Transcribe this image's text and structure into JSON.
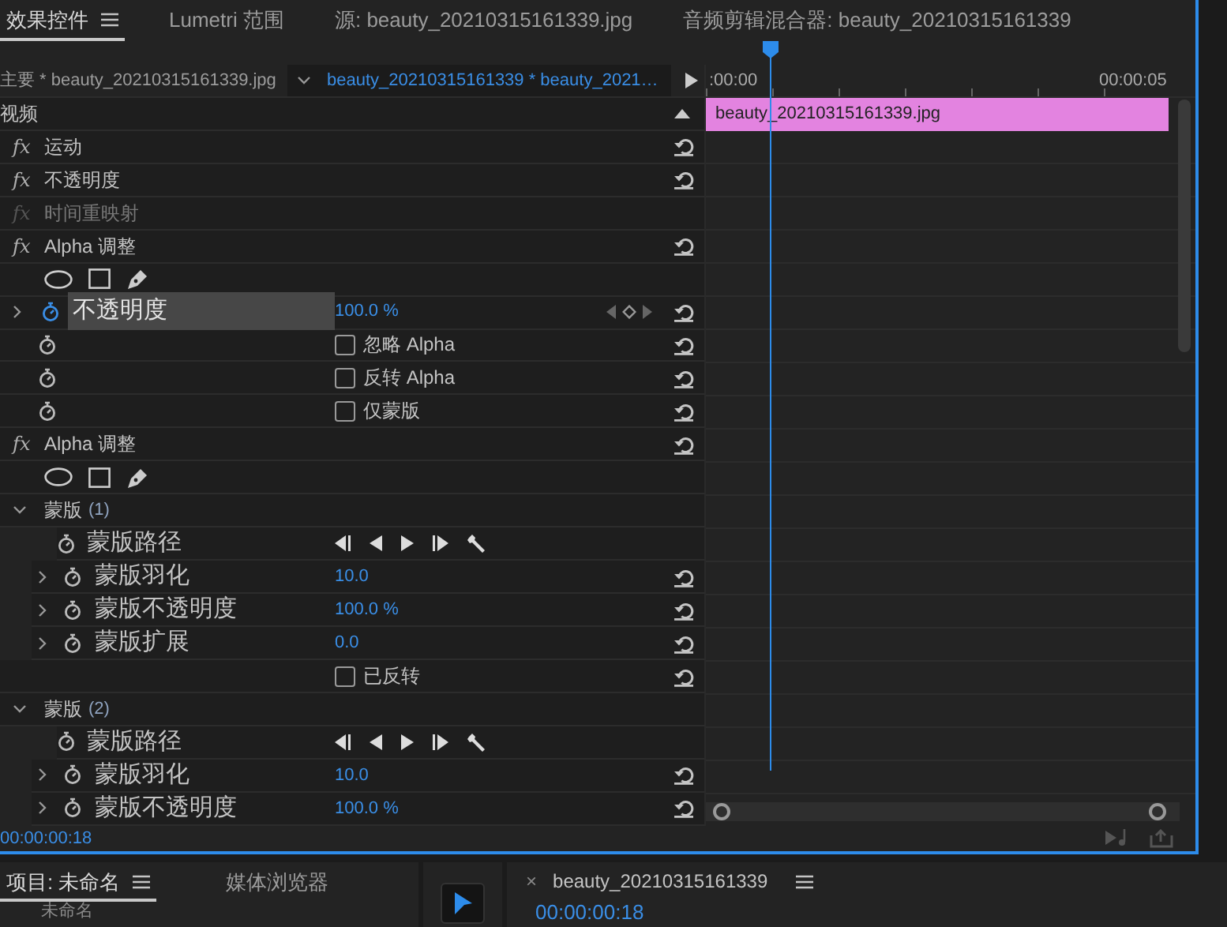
{
  "tabs": [
    {
      "label": "效果控件",
      "selected": true,
      "menu": true
    },
    {
      "label": "Lumetri 范围",
      "selected": false,
      "menu": false
    },
    {
      "label": "源: beauty_20210315161339.jpg",
      "selected": false,
      "menu": false
    },
    {
      "label": "音频剪辑混合器: beauty_20210315161339",
      "selected": false,
      "menu": false
    }
  ],
  "clip_selector": {
    "master": "主要 * beauty_20210315161339.jpg",
    "clip": "beauty_20210315161339 * beauty_2021…"
  },
  "effects": [
    {
      "kind": "section",
      "label": "视频",
      "expanded": true
    },
    {
      "kind": "effect",
      "fx": "fx",
      "label": "运动",
      "enabled": true
    },
    {
      "kind": "effect",
      "fx": "fx",
      "label": "不透明度",
      "enabled": true
    },
    {
      "kind": "effect",
      "fx": "fx",
      "label": "时间重映射",
      "enabled": false
    },
    {
      "kind": "effect",
      "fx": "fx",
      "label": "Alpha 调整",
      "enabled": true,
      "children": [
        {
          "kind": "mask-tools"
        },
        {
          "kind": "property",
          "label": "不透明度",
          "value": "100.0 %",
          "selected": true,
          "expanded": false,
          "animated": true
        },
        {
          "kind": "checkbox",
          "label": "忽略 Alpha",
          "checked": false,
          "stopwatch": true
        },
        {
          "kind": "checkbox",
          "label": "反转 Alpha",
          "checked": false,
          "stopwatch": true
        },
        {
          "kind": "checkbox",
          "label": "仅蒙版",
          "checked": false,
          "stopwatch": true
        }
      ]
    },
    {
      "kind": "effect",
      "fx": "fx",
      "label": "Alpha 调整",
      "enabled": true,
      "children": [
        {
          "kind": "mask-tools"
        },
        {
          "kind": "mask",
          "label": "蒙版",
          "number": "(1)",
          "expanded": true,
          "children": [
            {
              "kind": "mask-path",
              "label": "蒙版路径"
            },
            {
              "kind": "property",
              "label": "蒙版羽化",
              "value": "10.0",
              "selected": false,
              "expanded": false,
              "animated": false
            },
            {
              "kind": "property",
              "label": "蒙版不透明度",
              "value": "100.0 %",
              "selected": false,
              "expanded": false,
              "animated": false
            },
            {
              "kind": "property",
              "label": "蒙版扩展",
              "value": "0.0",
              "selected": false,
              "expanded": false,
              "animated": false
            },
            {
              "kind": "checkbox",
              "label": "已反转",
              "checked": false,
              "stopwatch": false
            }
          ]
        },
        {
          "kind": "mask",
          "label": "蒙版",
          "number": "(2)",
          "expanded": true,
          "children": [
            {
              "kind": "mask-path",
              "label": "蒙版路径"
            },
            {
              "kind": "property",
              "label": "蒙版羽化",
              "value": "10.0",
              "selected": false,
              "expanded": false,
              "animated": false
            },
            {
              "kind": "property",
              "label": "蒙版不透明度",
              "value": "100.0 %",
              "selected": false,
              "expanded": false,
              "animated": false
            }
          ]
        }
      ]
    }
  ],
  "timeline": {
    "start": ":00:00",
    "end": "00:00:05",
    "clip": "beauty_20210315161339.jpg"
  },
  "current_time": "00:00:00:18",
  "project_panel": {
    "tabs": [
      {
        "label": "项目: 未命名",
        "selected": true,
        "menu": true
      },
      {
        "label": "媒体浏览器",
        "selected": false,
        "menu": false
      }
    ],
    "item": "未命名"
  },
  "sequence_panel": {
    "close": "×",
    "title": "beauty_20210315161339",
    "time": "00:00:00:18"
  }
}
